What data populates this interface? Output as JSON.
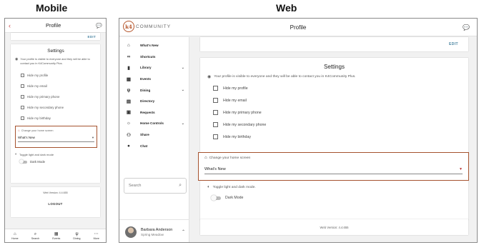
{
  "headings": {
    "mobile": "Mobile",
    "web": "Web"
  },
  "mobile": {
    "top_bar": {
      "back_icon": "chevron-left-icon",
      "title": "Profile",
      "chat_icon": "chat-bubble-icon"
    },
    "edit_label": "EDIT",
    "settings": {
      "title": "Settings",
      "visibility_text": "Your profile is visible to everyone and they will be able to contact you in K4Community Plus.",
      "options": [
        "Hide my profile",
        "Hide my email",
        "Hide my primary phone",
        "Hide my secondary phone",
        "Hide my birthday"
      ],
      "home_screen": {
        "label": "Change your home screen",
        "value": "What's New"
      },
      "toggle_label": "Toggle light and dark mode",
      "dark_mode_label": "Dark Mode"
    },
    "version": "Web Version: 4.4.655",
    "logout_label": "LOGOUT",
    "bottom_nav": [
      {
        "icon": "home-icon",
        "label": "Home"
      },
      {
        "icon": "search-icon",
        "label": "Search"
      },
      {
        "icon": "calendar-icon",
        "label": "Events"
      },
      {
        "icon": "fork-knife-icon",
        "label": "Dining"
      },
      {
        "icon": "more-icon",
        "label": "More"
      }
    ]
  },
  "web": {
    "logo_text": "COMMUNITY",
    "title": "Profile",
    "sidebar": [
      {
        "icon": "home-icon",
        "label": "What's New",
        "has_caret": false
      },
      {
        "icon": "link-icon",
        "label": "Shortcuts",
        "has_caret": false
      },
      {
        "icon": "book-icon",
        "label": "Library",
        "has_caret": true
      },
      {
        "icon": "calendar-icon",
        "label": "Events",
        "has_caret": false
      },
      {
        "icon": "fork-knife-icon",
        "label": "Dining",
        "has_caret": true
      },
      {
        "icon": "contact-card-icon",
        "label": "Directory",
        "has_caret": false
      },
      {
        "icon": "inbox-icon",
        "label": "Requests",
        "has_caret": false
      },
      {
        "icon": "lightbulb-icon",
        "label": "Home Controls",
        "has_caret": true
      },
      {
        "icon": "people-icon",
        "label": "Share",
        "has_caret": false
      },
      {
        "icon": "chat-bubble-icon",
        "label": "Chat",
        "has_caret": false
      }
    ],
    "search_placeholder": "Search",
    "user": {
      "name": "Barbara Anderson",
      "location": "Spring Meadow"
    },
    "edit_label": "EDIT",
    "settings": {
      "title": "Settings",
      "visibility_text": "Your profile is visible to everyone and they will be able to contact you in K4Community Plus.",
      "options": [
        "Hide my profile",
        "Hide my email",
        "Hide my primary phone",
        "Hide my secondary phone",
        "Hide my birthday"
      ],
      "home_screen": {
        "label": "Change your home screen",
        "value": "What's New"
      },
      "toggle_label": "Toggle light and dark mode.",
      "dark_mode_label": "Dark Mode"
    },
    "version": "Web Version: 4.4.655"
  }
}
